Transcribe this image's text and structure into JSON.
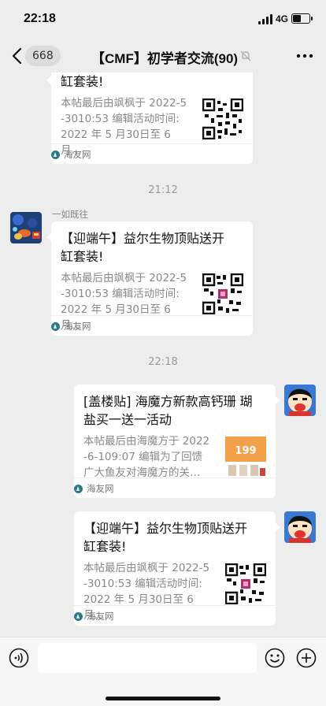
{
  "status": {
    "time": "22:18",
    "network": "4G",
    "battery_level": 0.55
  },
  "nav": {
    "unread_count": "668",
    "title": "【CMF】初学者交流(90)"
  },
  "messages": [
    {
      "title": "缸套装!",
      "desc_line1": "本帖最后由飒枫于 2022-5",
      "desc_line2": "-3010:53 编辑活动时间:",
      "desc_line3": "2022 年 5 月30日至 6 月…",
      "source": "海友网"
    },
    {
      "time_separator": "21:12",
      "sender": "一如既往",
      "title_line1": "【迎端午】益尔生物顶贴送开",
      "title_line2": "缸套装!",
      "desc_line1": "本帖最后由飒枫于 2022-5",
      "desc_line2": "-3010:53 编辑活动时间:",
      "desc_line3": "2022 年 5 月30日至 6 月…",
      "source": "海友网"
    },
    {
      "time_separator": "22:18",
      "title_line1": "[盖楼贴] 海魔方新款高钙珊 瑚",
      "title_line2": "盐买一送一活动",
      "desc_line1": "本帖最后由海魔方于 2022",
      "desc_line2": "-6-109:07 编辑为了回馈",
      "desc_line3": "广大鱼友对海魔方的关…",
      "thumb_text": "199",
      "source": "海友网"
    },
    {
      "title_line1": "【迎端午】益尔生物顶贴送开",
      "title_line2": "缸套装!",
      "desc_line1": "本帖最后由飒枫于 2022-5",
      "desc_line2": "-3010:53 编辑活动时间:",
      "desc_line3": "2022 年 5 月30日至 6 月…",
      "source": "海友网"
    }
  ],
  "input": {
    "placeholder": ""
  },
  "colors": {
    "background": "#ededed",
    "card": "#ffffff",
    "muted_text": "#888888",
    "accent_source": "#2a7a8a"
  },
  "icons": [
    "back-chevron-icon",
    "mute-icon",
    "more-icon",
    "voice-icon",
    "emoji-icon",
    "plus-icon"
  ]
}
